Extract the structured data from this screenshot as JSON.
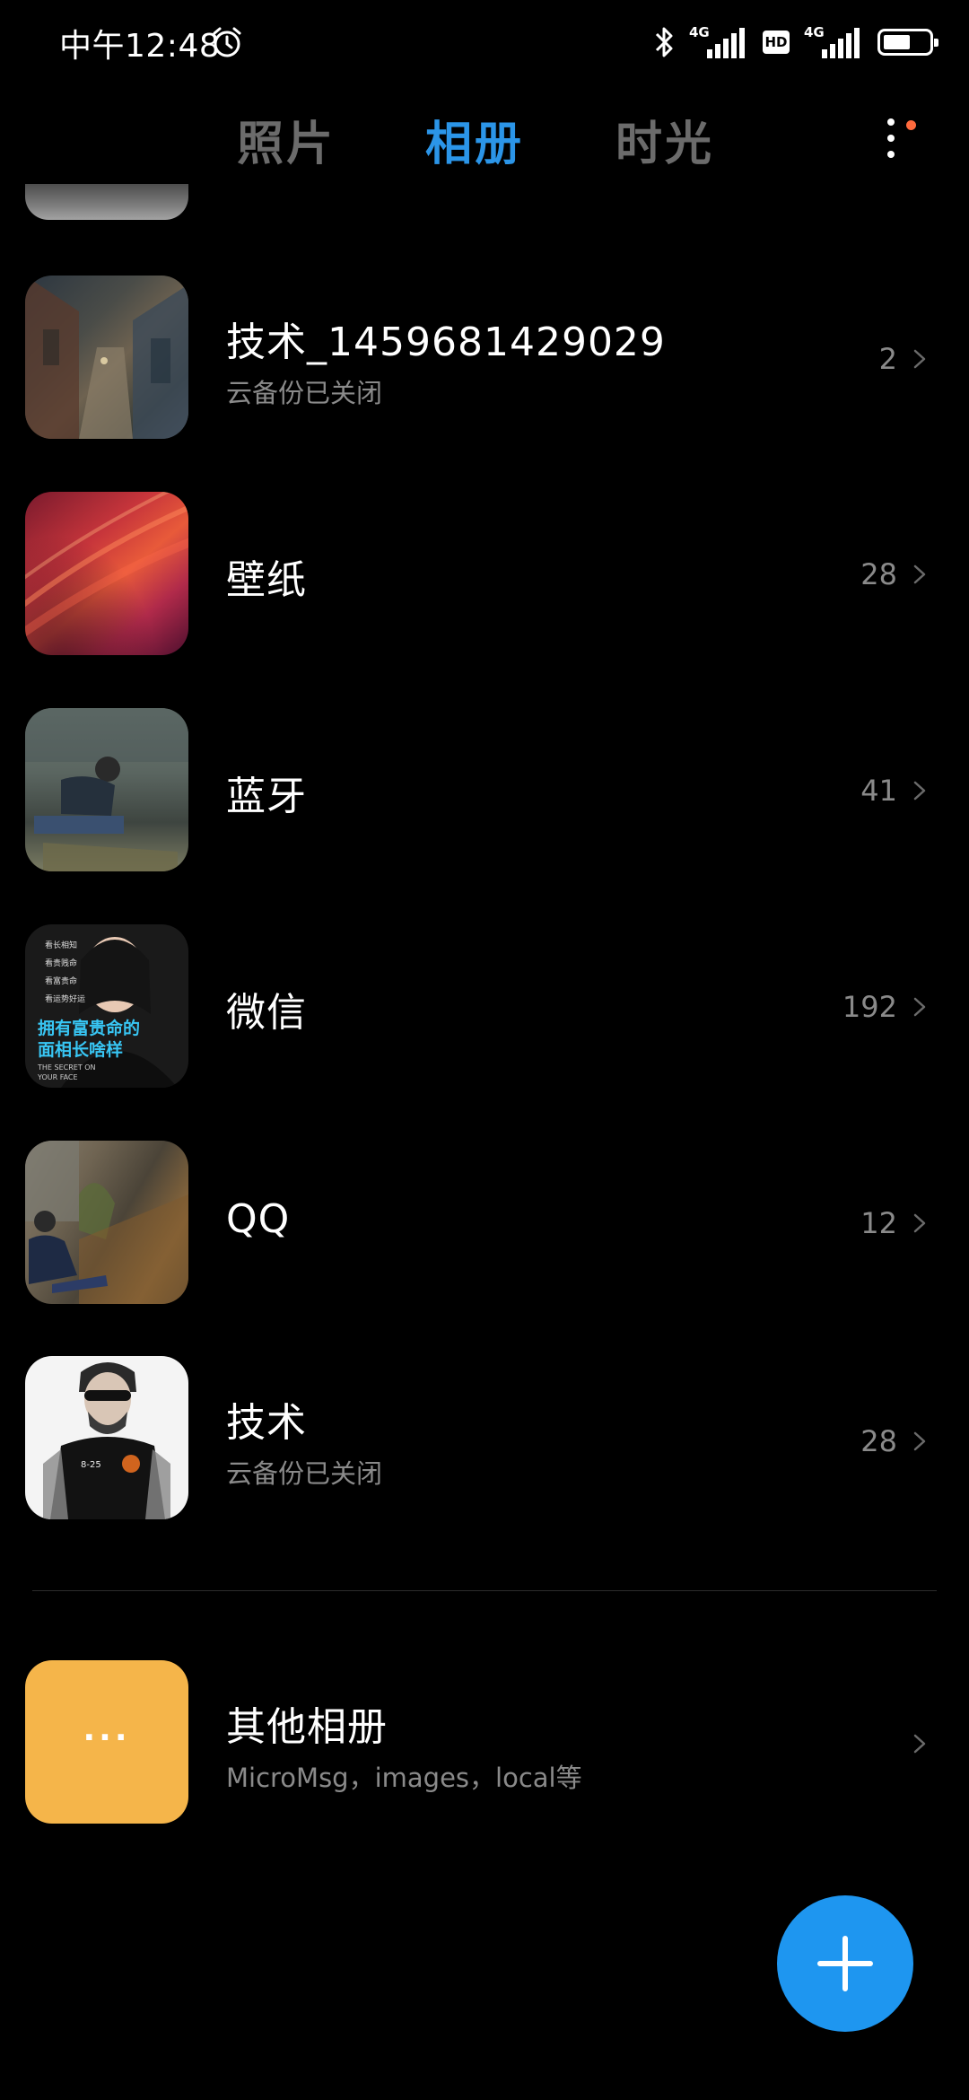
{
  "status_bar": {
    "time": "中午12:48",
    "signal_1_type": "4G",
    "hd_label": "HD",
    "signal_2_type": "4G",
    "icons": [
      "alarm-icon",
      "bluetooth-icon",
      "signal-icon",
      "hd-icon",
      "signal-icon",
      "battery-icon"
    ],
    "battery_level": 0.6
  },
  "tabs": {
    "items": [
      {
        "label": "照片",
        "active": false
      },
      {
        "label": "相册",
        "active": true
      },
      {
        "label": "时光",
        "active": false
      }
    ],
    "active_color": "#2b95e8",
    "inactive_color": "#6b6b6b",
    "more_icon": "more-vertical-icon",
    "notification_dot_color": "#ff6a3d"
  },
  "albums": [
    {
      "name": "技术_1459681429029",
      "subtitle": "云备份已关闭",
      "count": "2"
    },
    {
      "name": "壁纸",
      "subtitle": "",
      "count": "28"
    },
    {
      "name": "蓝牙",
      "subtitle": "",
      "count": "41"
    },
    {
      "name": "微信",
      "subtitle": "",
      "count": "192"
    },
    {
      "name": "QQ",
      "subtitle": "",
      "count": "12"
    },
    {
      "name": "技术",
      "subtitle": "云备份已关闭",
      "count": "28"
    }
  ],
  "thumbnail_texts": {
    "weixin_menu": [
      "看长相知",
      "看贵贱命",
      "看富贵命",
      "看运势好运"
    ],
    "weixin_headline_1": "拥有富贵命的",
    "weixin_headline_2": "面相长啥样",
    "weixin_caption_1": "THE SECRET ON",
    "weixin_caption_2": "YOUR FACE",
    "jishu_shirt": "8-25"
  },
  "other_albums": {
    "title": "其他相册",
    "subtitle": "MicroMsg，images，local等",
    "icon_text": "···",
    "icon_color": "#f5b54a"
  },
  "fab": {
    "icon": "plus-icon",
    "color": "#1e96f0"
  }
}
